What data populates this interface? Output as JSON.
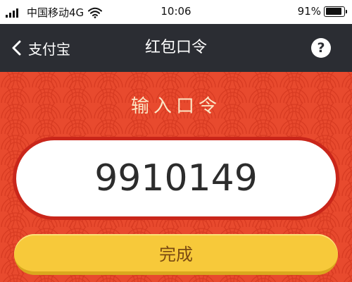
{
  "status_bar": {
    "carrier": "中国移动4G",
    "time": "10:06",
    "battery_percent": "91%",
    "battery_level": 0.91
  },
  "nav": {
    "back_label": "支付宝",
    "title": "红包口令",
    "help_label": "?"
  },
  "main": {
    "prompt": "输入口令",
    "code_value": "9910149",
    "submit_label": "完成"
  },
  "colors": {
    "background": "#e84a2e",
    "nav_background": "#2b2d33",
    "button": "#f7c93a",
    "prompt_text": "#fbe7c6"
  },
  "icons": {
    "signal": "signal-bars-icon",
    "wifi": "wifi-icon",
    "battery": "battery-icon",
    "back": "chevron-left-icon",
    "help": "question-circle-icon"
  }
}
